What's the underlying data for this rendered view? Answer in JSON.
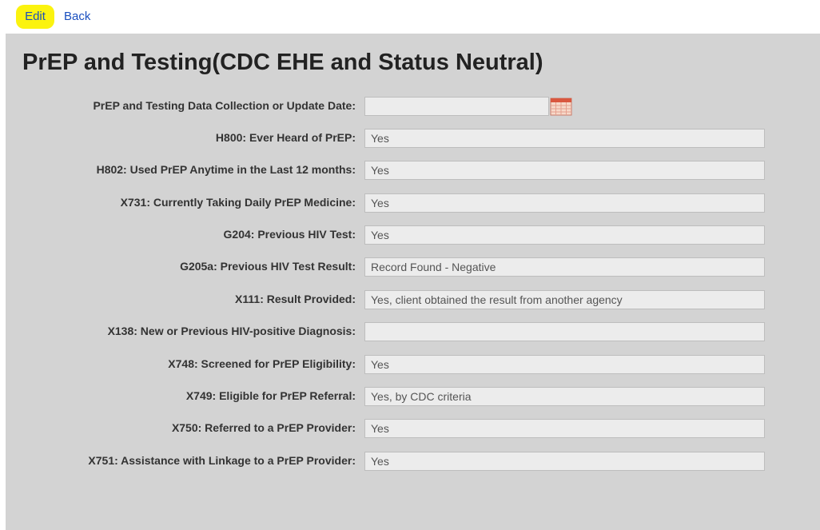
{
  "toolbar": {
    "edit_label": "Edit",
    "back_label": "Back",
    "highlight_color": "#fbf30f",
    "link_color": "#1a4fbf"
  },
  "page": {
    "title": "PrEP and Testing(CDC EHE and Status Neutral)",
    "background_color": "#d3d3d3"
  },
  "fields": [
    {
      "label": "PrEP and Testing Data Collection or Update Date:",
      "value": "",
      "type": "date",
      "icon": "calendar-icon"
    },
    {
      "label": "H800: Ever Heard of PrEP:",
      "value": "Yes"
    },
    {
      "label": "H802: Used PrEP Anytime in the Last 12 months:",
      "value": "Yes"
    },
    {
      "label": "X731: Currently Taking Daily PrEP Medicine:",
      "value": "Yes"
    },
    {
      "label": "G204: Previous HIV Test:",
      "value": "Yes"
    },
    {
      "label": "G205a: Previous HIV Test Result:",
      "value": "Record Found - Negative"
    },
    {
      "label": "X111: Result Provided:",
      "value": "Yes, client obtained the result from another agency"
    },
    {
      "label": "X138: New or Previous HIV-positive Diagnosis:",
      "value": ""
    },
    {
      "label": "X748: Screened for PrEP Eligibility:",
      "value": "Yes"
    },
    {
      "label": "X749: Eligible for PrEP Referral:",
      "value": "Yes, by CDC criteria"
    },
    {
      "label": "X750: Referred to a PrEP Provider:",
      "value": "Yes"
    },
    {
      "label": "X751: Assistance with Linkage to a PrEP Provider:",
      "value": "Yes"
    }
  ]
}
